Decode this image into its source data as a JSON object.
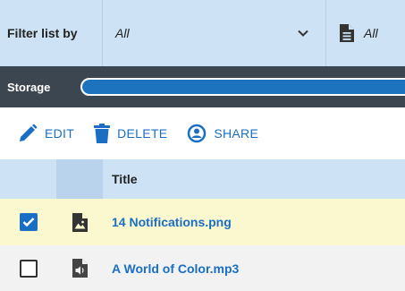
{
  "filter": {
    "label": "Filter list by",
    "selected": "All",
    "type_selected": "All"
  },
  "storage": {
    "label": "Storage",
    "used_fraction": 1.0
  },
  "toolbar": {
    "edit_label": "EDIT",
    "delete_label": "DELETE",
    "share_label": "SHARE"
  },
  "table": {
    "columns": [
      "",
      "",
      "Title"
    ],
    "rows": [
      {
        "title": "14 Notifications.png",
        "checked": true,
        "icon": "image-file-icon"
      },
      {
        "title": "A World of Color.mp3",
        "checked": false,
        "icon": "audio-file-icon"
      }
    ]
  },
  "colors": {
    "accent": "#1a6fc4",
    "filter_bg": "#cde2f5",
    "storage_bg": "#3c4650",
    "selected_row": "#fbf7cf"
  }
}
